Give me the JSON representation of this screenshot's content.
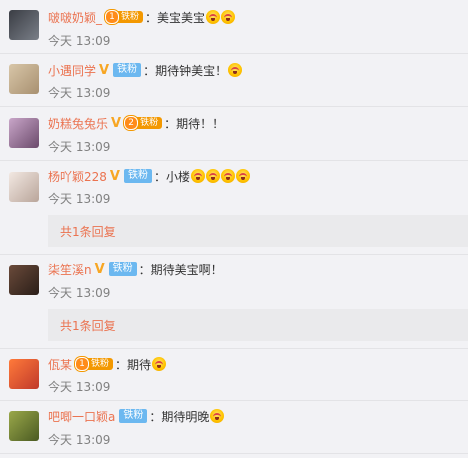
{
  "comments": [
    {
      "user": "啵啵奶颖_",
      "vip": false,
      "fan_type": "iron",
      "fan_level": "1",
      "fan_label": "铁粉",
      "text": "：美宝美宝",
      "emoji_count": 2,
      "time": "今天 13:09"
    },
    {
      "user": "小遇同学",
      "vip": true,
      "fan_type": "blue",
      "fan_label": "铁粉",
      "text": "：期待钟美宝！",
      "emoji_count": 1,
      "time": "今天 13:09"
    },
    {
      "user": "奶糕兔兔乐",
      "vip": true,
      "fan_type": "iron",
      "fan_level": "2",
      "fan_label": "铁粉",
      "text": "：期待！！",
      "emoji_count": 0,
      "time": "今天 13:09"
    },
    {
      "user": "杨吖颖228",
      "vip": true,
      "fan_type": "blue",
      "fan_label": "铁粉",
      "text": "：小楼",
      "emoji_count": 4,
      "time": "今天 13:09",
      "reply_summary": "共1条回复"
    },
    {
      "user": "柒笙溪n",
      "vip": true,
      "fan_type": "blue",
      "fan_label": "铁粉",
      "text": "：期待美宝啊！",
      "emoji_count": 0,
      "time": "今天 13:09",
      "reply_summary": "共1条回复"
    },
    {
      "user": "佤某",
      "vip": false,
      "fan_type": "iron",
      "fan_level": "1",
      "fan_label": "铁粉",
      "text": "：期待",
      "emoji_count": 1,
      "time": "今天 13:09"
    },
    {
      "user": "吧唧一口颖a",
      "vip": false,
      "fan_type": "blue",
      "fan_label": "铁粉",
      "text": "：期待明晚",
      "emoji_count": 1,
      "time": "今天 13:09"
    }
  ],
  "icons": {
    "vip_badge": "V",
    "emoji": "laughing-emoji-icon"
  },
  "colors": {
    "username": "#eb7350",
    "vip": "#f7a623",
    "iron_fan": "#f39800",
    "blue_fan": "#6cb8f0",
    "timestamp": "#808080"
  }
}
